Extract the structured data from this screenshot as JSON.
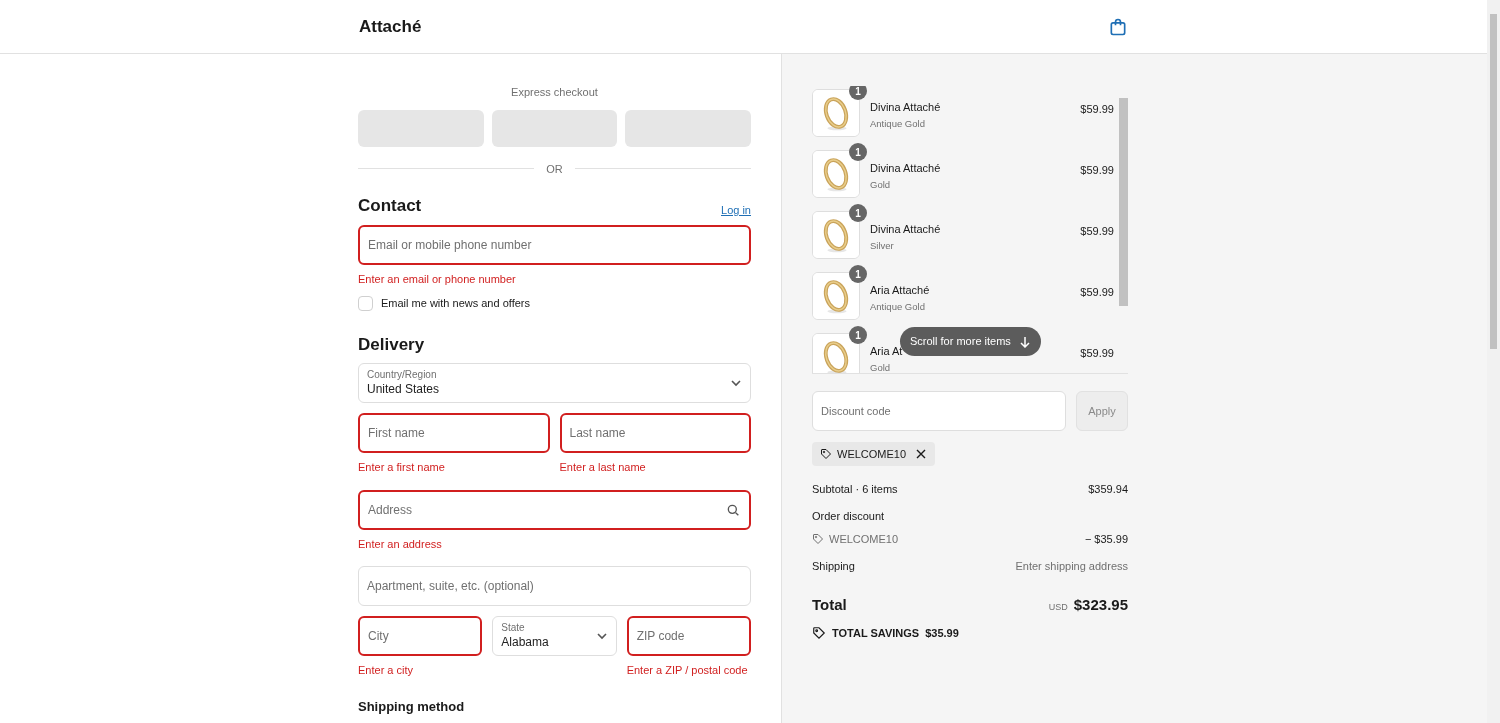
{
  "header": {
    "brand": "Attaché"
  },
  "express": {
    "title": "Express checkout",
    "divider": "OR"
  },
  "contact": {
    "title": "Contact",
    "login": "Log in",
    "field": {
      "placeholder": "Email or mobile phone number",
      "error": "Enter an email or phone number"
    },
    "newsletter": {
      "label": "Email me with news and offers",
      "checked": false
    }
  },
  "delivery": {
    "title": "Delivery",
    "rows": [
      [
        {
          "kind": "select",
          "label": "Country/Region",
          "value": "United States"
        }
      ],
      [
        {
          "kind": "input",
          "placeholder": "First name",
          "error": "Enter a first name"
        },
        {
          "kind": "input",
          "placeholder": "Last name",
          "error": "Enter a last name"
        }
      ],
      [
        {
          "kind": "search",
          "placeholder": "Address",
          "error": "Enter an address"
        }
      ],
      [
        {
          "kind": "input",
          "placeholder": "Apartment, suite, etc. (optional)"
        }
      ],
      [
        {
          "kind": "input",
          "placeholder": "City",
          "error": "Enter a city"
        },
        {
          "kind": "select",
          "label": "State",
          "value": "Alabama"
        },
        {
          "kind": "input",
          "placeholder": "ZIP code",
          "error": "Enter a ZIP / postal code"
        }
      ]
    ]
  },
  "shipping_method": {
    "title": "Shipping method"
  },
  "cart": {
    "items": [
      {
        "quantity": "1",
        "name": "Divina Attaché",
        "variant": "Antique Gold",
        "price": "$59.99"
      },
      {
        "quantity": "1",
        "name": "Divina Attaché",
        "variant": "Gold",
        "price": "$59.99"
      },
      {
        "quantity": "1",
        "name": "Divina Attaché",
        "variant": "Silver",
        "price": "$59.99"
      },
      {
        "quantity": "1",
        "name": "Aria Attaché",
        "variant": "Antique Gold",
        "price": "$59.99"
      },
      {
        "quantity": "1",
        "name": "Aria At",
        "variant": "Gold",
        "price": "$59.99"
      }
    ],
    "scroll_hint": "Scroll for more items"
  },
  "discount": {
    "placeholder": "Discount code",
    "button": "Apply",
    "applied": "WELCOME10"
  },
  "summary": {
    "subtotal_label": "Subtotal · 6 items",
    "subtotal": "$359.94",
    "discount_label": "Order discount",
    "discount_code": "WELCOME10",
    "discount_amount": "− $35.99",
    "shipping_label": "Shipping",
    "shipping_value": "Enter shipping address",
    "total_label": "Total",
    "currency": "USD",
    "total": "$323.95",
    "savings_label": "TOTAL SAVINGS",
    "savings": "$35.99"
  }
}
